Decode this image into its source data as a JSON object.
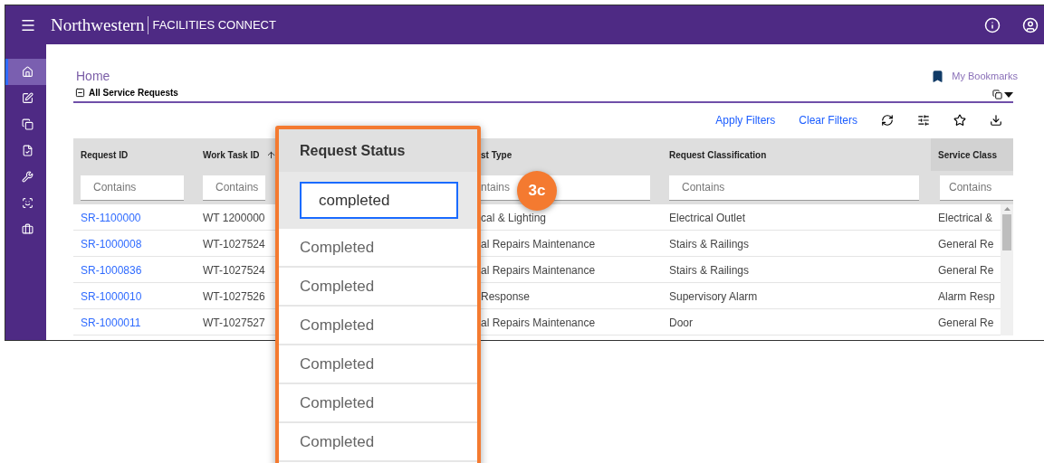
{
  "top_bar": {
    "brand": "Northwestern",
    "product": "FACILITIES CONNECT"
  },
  "sidebar": {
    "items": [
      {
        "selected": true
      },
      {
        "selected": false
      },
      {
        "selected": false
      },
      {
        "selected": false
      },
      {
        "selected": false
      },
      {
        "selected": false
      },
      {
        "selected": false
      }
    ]
  },
  "page": {
    "title": "Home",
    "bookmarks": "My Bookmarks"
  },
  "panel": {
    "title": "All Service Requests",
    "expanded": true,
    "actions": [
      "Apply Filters",
      "Clear Filters"
    ]
  },
  "table": {
    "columns": [
      {
        "label": "Request ID",
        "placeholder": "Contains",
        "sorted": false
      },
      {
        "label": "Work Task ID",
        "placeholder": "Contains",
        "sorted": true
      },
      {
        "label": "st Type",
        "placeholder": "ntains",
        "sorted": false
      },
      {
        "label": "Request Classification",
        "placeholder": "Contains",
        "sorted": false
      },
      {
        "label": "Service Class",
        "placeholder": "Contains",
        "sorted": false
      }
    ],
    "rows": [
      [
        "SR-1100000",
        "WT 1200000",
        "cal & Lighting",
        "Electrical Outlet",
        "Electrical &"
      ],
      [
        "SR-1000008",
        "WT-1027524",
        "al Repairs Maintenance",
        "Stairs & Railings",
        "General Re"
      ],
      [
        "SR-1000836",
        "WT-1027524",
        "al Repairs Maintenance",
        "Stairs & Railings",
        "General Re"
      ],
      [
        "SR-1000010",
        "WT-1027526",
        "Response",
        "Supervisory Alarm",
        "Alarm Resp"
      ],
      [
        "SR-1000011",
        "WT-1027527",
        "al Repairs Maintenance",
        "Door",
        "General Re"
      ]
    ]
  },
  "callout": {
    "badge": "3c",
    "column": "Request Status",
    "filter_value": "completed",
    "values": [
      "Completed",
      "Completed",
      "Completed",
      "Completed",
      "Completed",
      "Completed"
    ]
  }
}
